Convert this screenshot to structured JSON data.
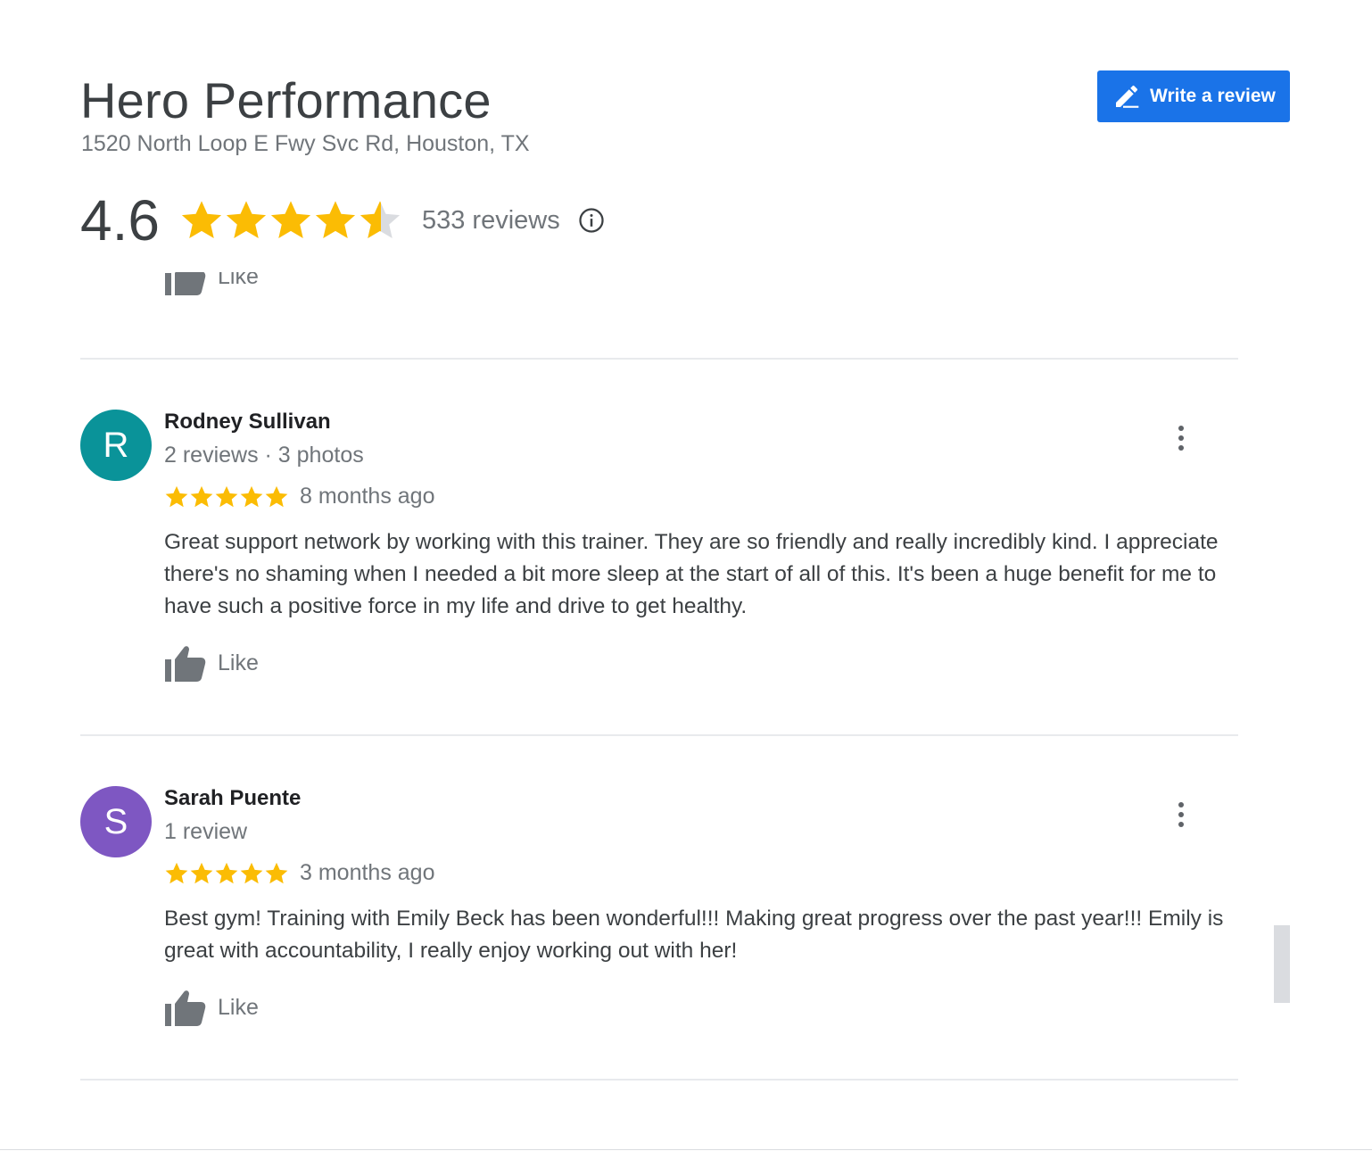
{
  "business": {
    "name": "Hero Performance",
    "address": "1520 North Loop E Fwy Svc Rd, Houston, TX",
    "rating": "4.6",
    "rating_value": 4.6,
    "review_count": "533 reviews",
    "write_review_label": "Write a review"
  },
  "colors": {
    "accent": "#1a73e8",
    "star": "#fbbc04",
    "star_empty": "#dadce0",
    "avatar_r": "#0a9399",
    "avatar_s": "#7e57c2",
    "icon_gray": "#70757a"
  },
  "icons": {
    "write": "pencil-icon",
    "info": "info-icon",
    "star": "star-icon",
    "like": "thumbs-up-icon",
    "menu": "more-vert-icon"
  },
  "partial_like_label": "Like",
  "reviews": [
    {
      "initial": "R",
      "name": "Rodney Sullivan",
      "meta": "2 reviews · 3 photos",
      "stars": 5,
      "time": "8 months ago",
      "text": "Great support network by working with this trainer. They are so friendly and really incredibly kind. I appreciate there's no shaming when I needed a bit more sleep at the start of all of this. It's been a huge benefit for me to have such a positive force in my life and drive to get healthy.",
      "like_label": "Like"
    },
    {
      "initial": "S",
      "name": "Sarah Puente",
      "meta": "1 review",
      "stars": 5,
      "time": "3 months ago",
      "text": "Best gym! Training with Emily Beck has been wonderful!!! Making great progress over the past year!!! Emily is great with accountability, I really enjoy working out with her!",
      "like_label": "Like"
    }
  ]
}
